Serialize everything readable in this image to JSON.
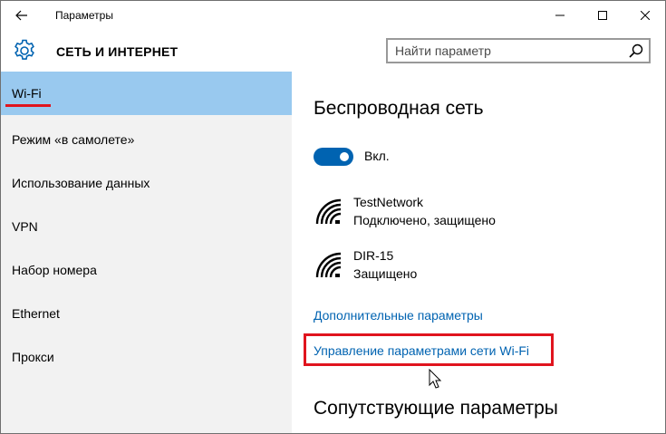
{
  "window": {
    "title": "Параметры"
  },
  "header": {
    "section_title": "СЕТЬ И ИНТЕРНЕТ",
    "search_placeholder": "Найти параметр"
  },
  "sidebar": {
    "items": [
      {
        "label": "Wi-Fi",
        "active": true
      },
      {
        "label": "Режим «в самолете»",
        "active": false
      },
      {
        "label": "Использование данных",
        "active": false
      },
      {
        "label": "VPN",
        "active": false
      },
      {
        "label": "Набор номера",
        "active": false
      },
      {
        "label": "Ethernet",
        "active": false
      },
      {
        "label": "Прокси",
        "active": false
      }
    ]
  },
  "main": {
    "heading": "Беспроводная сеть",
    "toggle": {
      "label": "Вкл.",
      "on": true
    },
    "networks": [
      {
        "name": "TestNetwork",
        "status": "Подключено, защищено"
      },
      {
        "name": "DIR-15",
        "status": "Защищено"
      }
    ],
    "links": {
      "advanced": "Дополнительные параметры",
      "manage": "Управление параметрами сети Wi-Fi"
    },
    "related_heading": "Сопутствующие параметры"
  },
  "colors": {
    "accent": "#0063b1",
    "active_nav": "#99c9ef",
    "sidebar_bg": "#f2f2f2",
    "annotation_red": "#e0141e"
  },
  "icons": {
    "back": "back-arrow-icon",
    "minimize": "minimize-icon",
    "maximize": "maximize-icon",
    "close": "close-icon",
    "settings": "gear-icon",
    "search": "search-icon",
    "wifi": "wifi-signal-icon",
    "cursor": "mouse-cursor-icon"
  }
}
